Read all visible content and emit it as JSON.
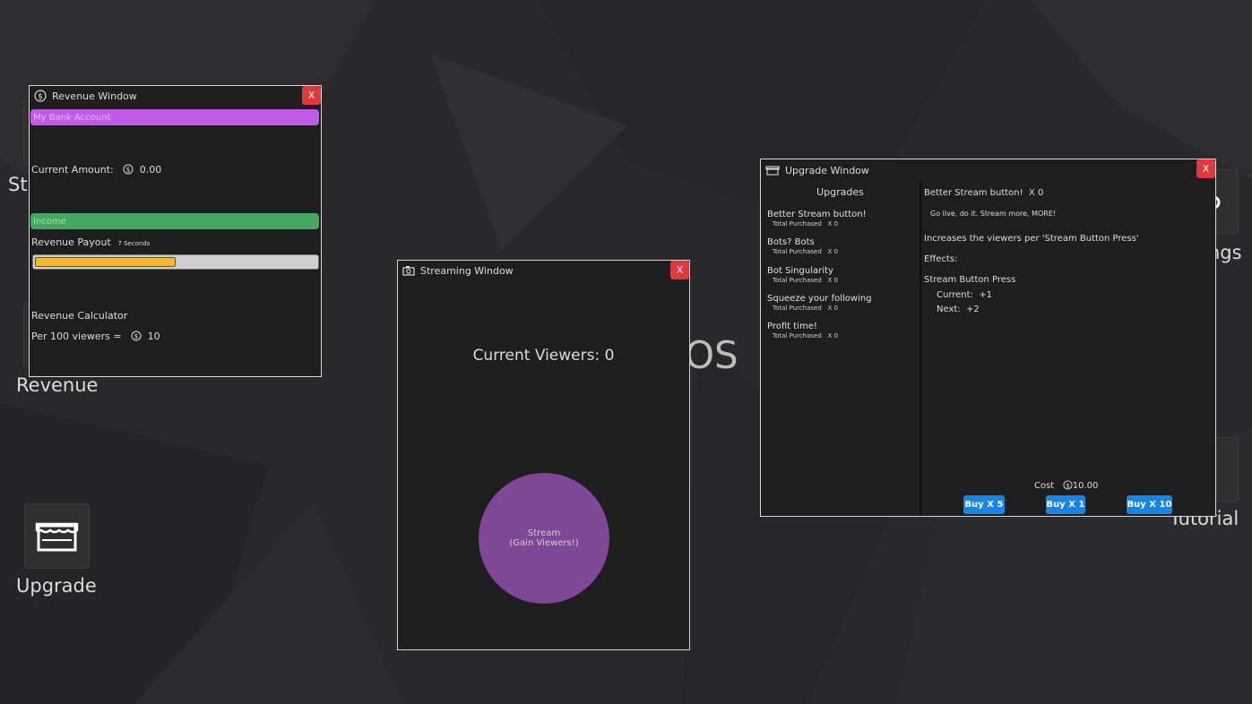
{
  "desktop": {
    "title_fragment": "OS",
    "icons": [
      {
        "label": "St",
        "icon": "stream-icon"
      },
      {
        "label": "Revenue",
        "icon": "revenue-icon"
      },
      {
        "label": "Upgrade",
        "icon": "shop-icon"
      },
      {
        "label": "ngs",
        "icon": "gear-icon"
      },
      {
        "label": "Tutorial",
        "icon": "tutorial-icon"
      }
    ]
  },
  "revenue_window": {
    "title": "Revenue Window",
    "close_label": "X",
    "bank_header": "My Bank Account",
    "current_amount_label": "Current Amount:",
    "current_amount_value": "0.00",
    "income_header": "Income",
    "payout_label": "Revenue Payout",
    "payout_interval": "7 Seconds",
    "payout_progress": 0.5,
    "calculator_label": "Revenue Calculator",
    "per_viewers_label": "Per 100 viewers =",
    "per_viewers_value": "10",
    "colors": {
      "bank": "#c05ae8",
      "income": "#45a862",
      "progress": "#f4b62c"
    }
  },
  "streaming_window": {
    "title": "Streaming Window",
    "close_label": "X",
    "viewers_label": "Current Viewers:",
    "viewers_value": "0",
    "stream_button_line1": "Stream",
    "stream_button_line2": "(Gain Viewers!)",
    "stream_color": "#7e4896"
  },
  "upgrade_window": {
    "title": "Upgrade Window",
    "close_label": "X",
    "list_header": "Upgrades",
    "items": [
      {
        "name": "Better Stream button!",
        "purchased_label": "Total Purchased",
        "count": "X  0"
      },
      {
        "name": "Bots? Bots",
        "purchased_label": "Total Purchased",
        "count": "X  0"
      },
      {
        "name": "Bot Singularity",
        "purchased_label": "Total Purchased",
        "count": "X  0"
      },
      {
        "name": "Squeeze your following",
        "purchased_label": "Total Purchased",
        "count": "X  0"
      },
      {
        "name": "Profit time!",
        "purchased_label": "Total Purchased",
        "count": "X  0"
      }
    ],
    "detail": {
      "name": "Better Stream button!",
      "count": "X  0",
      "tagline": "Go live, do it. Stream more, MORE!",
      "description": "Increases the viewers per 'Stream Button Press'",
      "effects_label": "Effects:",
      "effect_name": "Stream Button Press",
      "current_label": "Current:",
      "current_value": "+1",
      "next_label": "Next:",
      "next_value": "+2",
      "cost_label": "Cost",
      "cost_value": "10.00"
    },
    "buy_buttons": [
      "Buy X 5",
      "Buy X 1",
      "Buy X 10"
    ],
    "buy_color": "#1784e8"
  }
}
